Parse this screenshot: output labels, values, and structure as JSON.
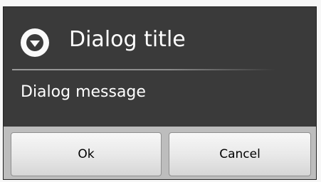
{
  "dialog": {
    "title": "Dialog title",
    "title_icon": "down-arrow-circle-icon",
    "message": "Dialog message",
    "buttons": {
      "ok_label": "Ok",
      "cancel_label": "Cancel"
    }
  },
  "colors": {
    "dialog_background": "#3a3a3a",
    "title_text": "#ffffff",
    "button_bar": "#bdbdbd"
  }
}
